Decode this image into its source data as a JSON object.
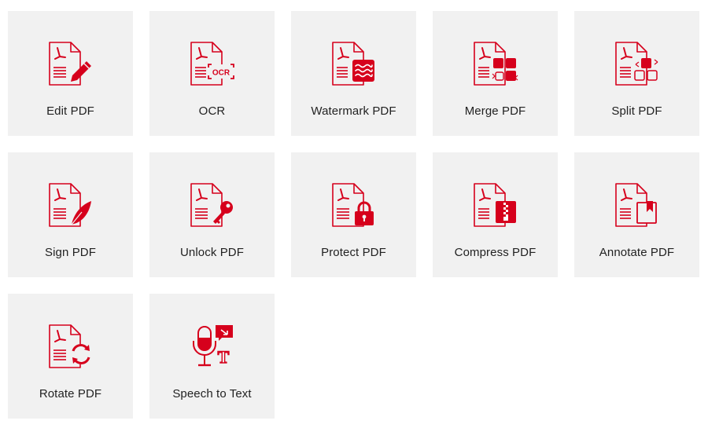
{
  "accent_color": "#d6001c",
  "tools": [
    {
      "label": "Edit PDF",
      "icon": "edit-pdf-icon"
    },
    {
      "label": "OCR",
      "icon": "ocr-icon",
      "badge": "OCR"
    },
    {
      "label": "Watermark PDF",
      "icon": "watermark-pdf-icon"
    },
    {
      "label": "Merge PDF",
      "icon": "merge-pdf-icon"
    },
    {
      "label": "Split PDF",
      "icon": "split-pdf-icon"
    },
    {
      "label": "Sign PDF",
      "icon": "sign-pdf-icon"
    },
    {
      "label": "Unlock PDF",
      "icon": "unlock-pdf-icon"
    },
    {
      "label": "Protect PDF",
      "icon": "protect-pdf-icon"
    },
    {
      "label": "Compress PDF",
      "icon": "compress-pdf-icon"
    },
    {
      "label": "Annotate PDF",
      "icon": "annotate-pdf-icon"
    },
    {
      "label": "Rotate PDF",
      "icon": "rotate-pdf-icon"
    },
    {
      "label": "Speech to Text",
      "icon": "speech-to-text-icon",
      "badge": "T"
    }
  ]
}
